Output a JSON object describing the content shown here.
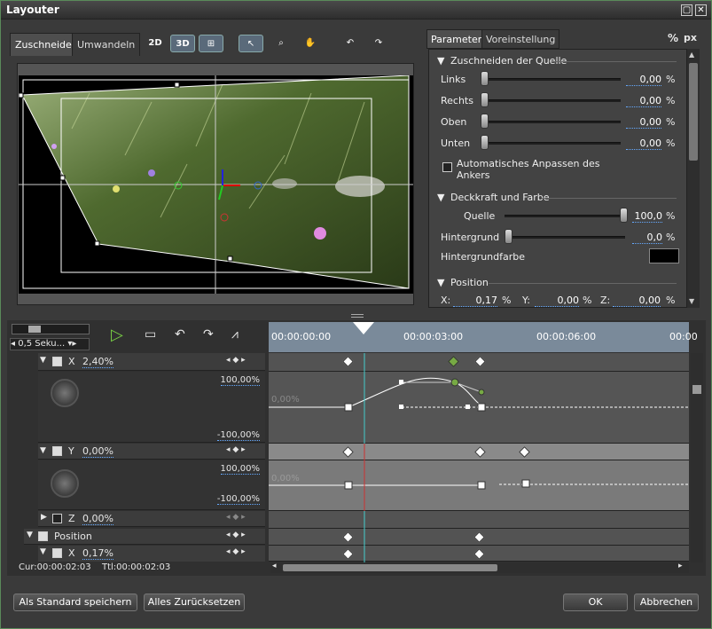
{
  "window": {
    "title": "Layouter"
  },
  "left_tabs": [
    {
      "label": "Zuschneiden"
    },
    {
      "label": "Umwandeln"
    }
  ],
  "tools": {
    "2d": "2D",
    "3d": "3D"
  },
  "right_tabs": [
    {
      "label": "Parameter"
    },
    {
      "label": "Voreinstellung"
    }
  ],
  "units": {
    "percent": "%",
    "px": "px"
  },
  "sections": {
    "crop": {
      "title": "Zuschneiden der Quelle",
      "rows": [
        {
          "label": "Links",
          "value": "0,00",
          "unit": "%"
        },
        {
          "label": "Rechts",
          "value": "0,00",
          "unit": "%"
        },
        {
          "label": "Oben",
          "value": "0,00",
          "unit": "%"
        },
        {
          "label": "Unten",
          "value": "0,00",
          "unit": "%"
        }
      ],
      "auto_anchor": "Automatisches Anpassen des Ankers"
    },
    "opacity": {
      "title": "Deckkraft und Farbe",
      "source_label": "Quelle",
      "source_value": "100,0",
      "source_unit": "%",
      "bg_label": "Hintergrund",
      "bg_value": "0,0",
      "bg_unit": "%",
      "bgcolor_label": "Hintergrundfarbe",
      "bgcolor": "#000000"
    },
    "position": {
      "title": "Position",
      "x_label": "X:",
      "x_value": "0,17",
      "y_label": "Y:",
      "y_value": "0,00",
      "z_label": "Z:",
      "z_value": "0,00",
      "unit": "%"
    }
  },
  "timeline": {
    "speed": "0,5 Seku...",
    "ruler": [
      "00:00:00:00",
      "00:00:03:00",
      "00:00:06:00",
      "00:00"
    ],
    "tracks": {
      "x": {
        "label": "X",
        "value": "2,40%",
        "max": "100,00%",
        "min": "-100,00%",
        "zero": "0,00%"
      },
      "y": {
        "label": "Y",
        "value": "0,00%",
        "max": "100,00%",
        "min": "-100,00%",
        "zero": "0,00%"
      },
      "z": {
        "label": "Z",
        "value": "0,00%"
      },
      "position": {
        "label": "Position"
      },
      "x2": {
        "label": "X",
        "value": "0,17%"
      }
    },
    "cur": "Cur:00:00:02:03",
    "ttl": "Ttl:00:00:02:03"
  },
  "buttons": {
    "save_default": "Als Standard speichern",
    "reset_all": "Alles Zurücksetzen",
    "ok": "OK",
    "cancel": "Abbrechen"
  }
}
